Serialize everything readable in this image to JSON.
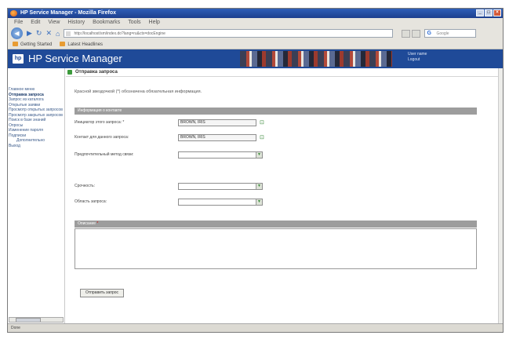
{
  "window": {
    "title": "HP Service Manager - Mozilla Firefox",
    "controls": [
      "_",
      "□",
      "×"
    ]
  },
  "menubar": [
    "File",
    "Edit",
    "View",
    "History",
    "Bookmarks",
    "Tools",
    "Help"
  ],
  "navbar": {
    "back_icon": "back-arrow-icon",
    "url": "http://localhost/sm/index.do?lang=ru&ctx=docEngine",
    "search_placeholder": "Google"
  },
  "bookmarks": [
    "Getting Started",
    "Latest Headlines"
  ],
  "header": {
    "logo": "hp",
    "title": "HP Service Manager",
    "user_line1": "User name",
    "user_line2": "Logout"
  },
  "sidebar": {
    "items": [
      {
        "label": "Главное меню",
        "active": false,
        "sub": false
      },
      {
        "label": "Отправка запроса",
        "active": true,
        "sub": false
      },
      {
        "label": "Запрос из каталога",
        "active": false,
        "sub": false
      },
      {
        "label": "Открытые заявки",
        "active": false,
        "sub": false
      },
      {
        "label": "Просмотр открытых запросов",
        "active": false,
        "sub": false
      },
      {
        "label": "Просмотр закрытых запросов",
        "active": false,
        "sub": false
      },
      {
        "label": "Поиск в базе знаний",
        "active": false,
        "sub": false
      },
      {
        "label": "Опросы",
        "active": false,
        "sub": false
      },
      {
        "label": "Изменение пароля",
        "active": false,
        "sub": false
      },
      {
        "label": "Подписки",
        "active": false,
        "sub": false
      },
      {
        "label": "Дополнительно",
        "active": false,
        "sub": true
      },
      {
        "label": "Выход",
        "active": false,
        "sub": false
      }
    ]
  },
  "page": {
    "title": "Отправка запроса",
    "notice": "Красной звездочкой (*) обозначена обязательная информация.",
    "section_title": "Информация о контакте",
    "description_title": "Описание",
    "required_mark": "*",
    "fields": {
      "requester_label": "Инициатор этого запроса: *",
      "requester_value": "BROWN, IRIS",
      "contact_label": "Контакт для данного запроса:",
      "contact_value": "BROWN, IRIS",
      "contact_method_label": "Предпочтительный метод связи:",
      "urgency_label": "Срочность:",
      "area_label": "Область запроса:"
    },
    "submit_label": "Отправить запрос"
  },
  "status": {
    "text": "Done"
  }
}
